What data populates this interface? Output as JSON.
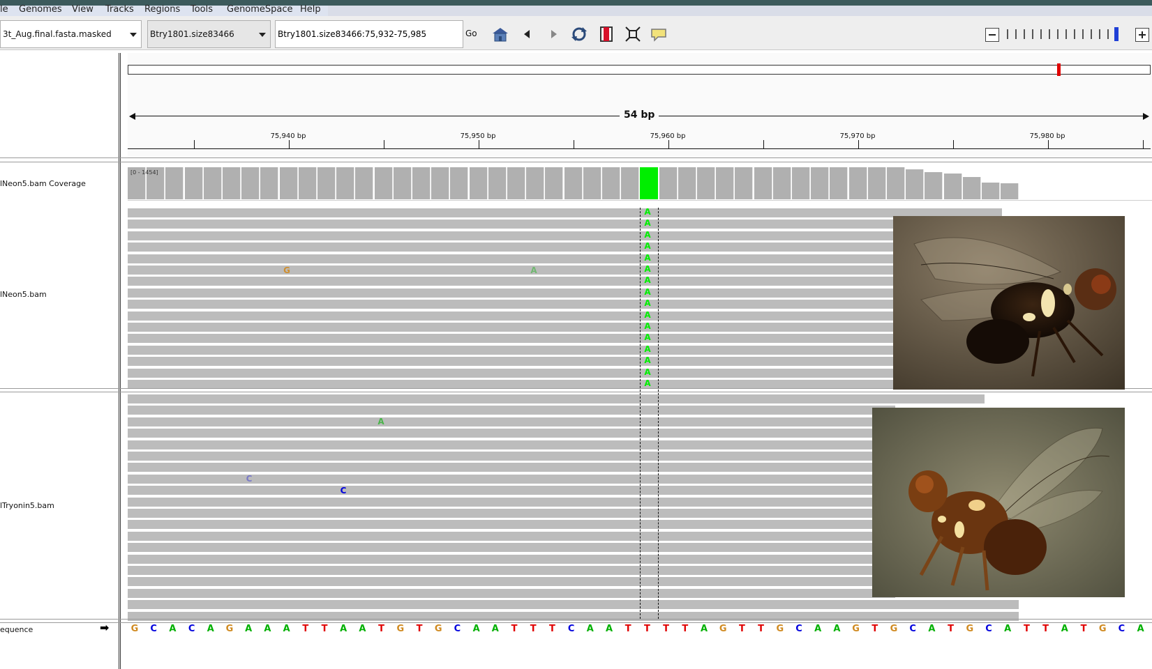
{
  "menu": {
    "items": [
      "le",
      "Genomes",
      "View",
      "Tracks",
      "Regions",
      "Tools",
      "GenomeSpace",
      "Help"
    ]
  },
  "toolbar": {
    "genome": "3t_Aug.final.fasta.masked",
    "chromosome": "Btry1801.size83466",
    "locus": "Btry1801.size83466:75,932-75,985",
    "go_label": "Go",
    "icons": [
      "home-icon",
      "back-icon",
      "forward-icon",
      "refresh-icon",
      "roi-icon",
      "fit-window-icon",
      "popup-info-icon"
    ],
    "zoom_level_fraction": 0.9
  },
  "ruler": {
    "span_label": "54 bp",
    "ticks": [
      "75,940 bp",
      "75,950 bp",
      "75,960 bp",
      "75,970 bp",
      "75,980 bp"
    ]
  },
  "tracks": {
    "coverage_label": "lNeon5.bam Coverage",
    "coverage_range": "[0 - 1454]",
    "neon_label": "lNeon5.bam",
    "tryonin_label": "lTryonin5.bam",
    "sequence_label": "equence",
    "sequence_arrow": "➡"
  },
  "sequence": [
    "G",
    "C",
    "A",
    "C",
    "A",
    "G",
    "A",
    "A",
    "A",
    "T",
    "T",
    "A",
    "A",
    "T",
    "G",
    "T",
    "G",
    "C",
    "A",
    "A",
    "T",
    "T",
    "T",
    "C",
    "A",
    "A",
    "T",
    "T",
    "T",
    "T",
    "A",
    "G",
    "T",
    "T",
    "G",
    "C",
    "A",
    "A",
    "G",
    "T",
    "G",
    "C",
    "A",
    "T",
    "G",
    "C",
    "A",
    "T",
    "T",
    "A",
    "T",
    "G",
    "C",
    "A"
  ],
  "mismatches": {
    "neon_column": [
      "A",
      "A",
      "A",
      "A",
      "A",
      "A",
      "A",
      "A",
      "A",
      "A",
      "A",
      "A",
      "A",
      "A",
      "A",
      "A"
    ],
    "neon_other": [
      "G",
      "A"
    ],
    "tryonin_other": [
      "A",
      "C",
      "C"
    ]
  },
  "colors": {
    "A": "#00b000",
    "C": "#0000dd",
    "G": "#d08a20",
    "T": "#e00000",
    "highlight": "#00ee00"
  }
}
